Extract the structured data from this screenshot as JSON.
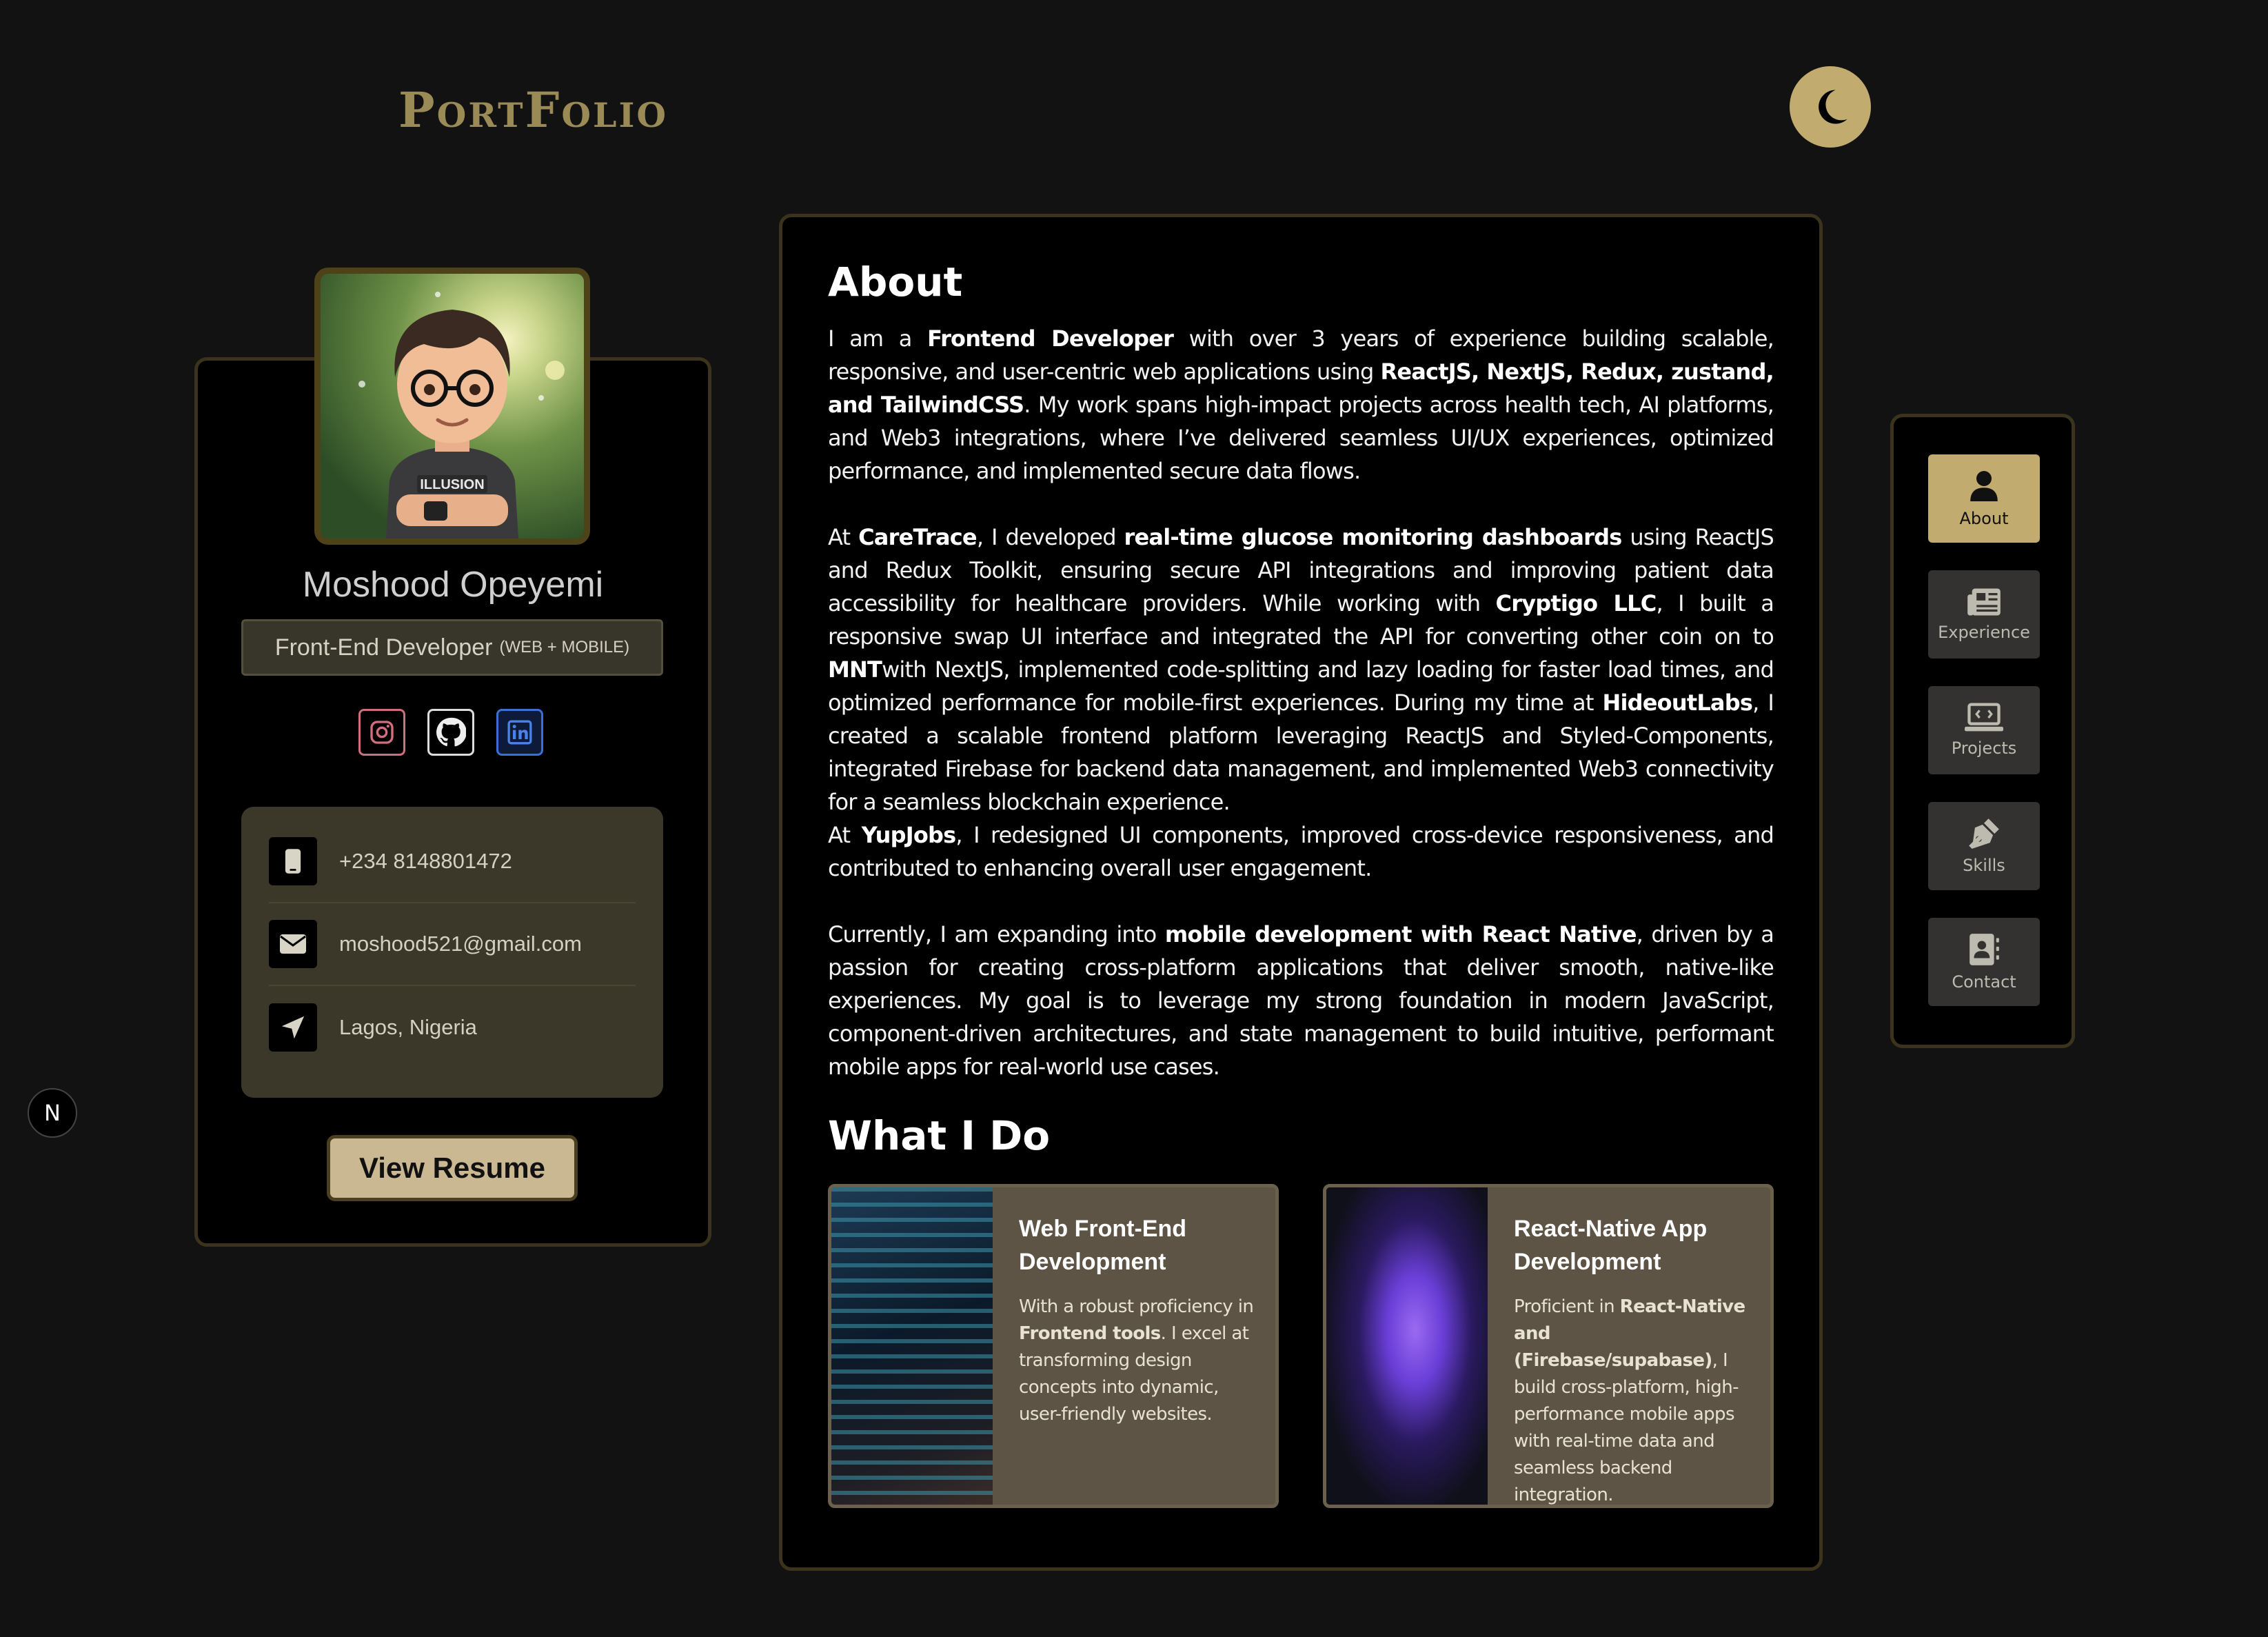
{
  "header": {
    "logo": "PortFolio",
    "theme_toggle_icon": "moon-icon"
  },
  "profile": {
    "name": "Moshood Opeyemi",
    "role": "Front-End Developer",
    "role_sub": "(WEB + MOBILE)",
    "socials": [
      {
        "icon": "instagram-icon"
      },
      {
        "icon": "github-icon"
      },
      {
        "icon": "linkedin-icon"
      }
    ],
    "contacts": {
      "phone": "+234 8148801472",
      "email": "moshood521@gmail.com",
      "location": "Lagos, Nigeria"
    },
    "resume_label": "View Resume"
  },
  "about": {
    "title": "About",
    "p1": {
      "a": "I am a ",
      "b1": "Frontend Developer",
      "c": " with over 3 years of experience building scalable, responsive, and user-centric web applications using ",
      "b2": "ReactJS, NextJS, Redux, zustand, and TailwindCSS",
      "d": ". My work spans high-impact projects across health tech, AI platforms, and Web3 integrations, where I’ve delivered seamless UI/UX experiences, optimized performance, and implemented secure data flows."
    },
    "p2": {
      "a": "At ",
      "b1": "CareTrace",
      "c": ", I developed ",
      "b2": "real-time glucose monitoring dashboards",
      "d": " using ReactJS and Redux Toolkit, ensuring secure API integrations and improving patient data accessibility for healthcare providers. While working with ",
      "b3": "Cryptigo LLC",
      "e": ", I built a responsive swap UI interface and integrated the API for converting other coin on to ",
      "b4": "MNT",
      "f": "with NextJS, implemented code-splitting and lazy loading for faster load times, and optimized performance for mobile-first experiences. During my time at ",
      "b5": "HideoutLabs",
      "g": ", I created a scalable frontend platform leveraging ReactJS and Styled-Components, integrated Firebase for backend data management, and implemented Web3 connectivity for a seamless blockchain experience."
    },
    "p3": {
      "a": "At ",
      "b1": "YupJobs",
      "c": ", I redesigned UI components, improved cross-device responsiveness, and contributed to enhancing overall user engagement."
    },
    "p4": {
      "a": "Currently, I am expanding into ",
      "b1": "mobile development with React Native",
      "c": ", driven by a passion for creating cross-platform applications that deliver smooth, native-like experiences. My goal is to leverage my strong foundation in modern JavaScript, component-driven architectures, and state management to build intuitive, performant mobile apps for real-world use cases."
    }
  },
  "what_i_do": {
    "title": "What I Do",
    "services": [
      {
        "title": "Web Front-End Development",
        "desc_a": "With a robust proficiency in ",
        "desc_b": "Frontend tools",
        "desc_c": ". I excel at transforming design concepts into dynamic, user-friendly websites."
      },
      {
        "title": "React-Native App Development",
        "desc_a": "Proficient in ",
        "desc_b": "React-Native and (Firebase/supabase)",
        "desc_c": ", I build cross-platform, high-performance mobile apps with real-time data and seamless backend integration."
      }
    ]
  },
  "nav": {
    "items": [
      {
        "label": "About",
        "icon": "user-icon",
        "active": true
      },
      {
        "label": "Experience",
        "icon": "newspaper-icon"
      },
      {
        "label": "Projects",
        "icon": "laptop-code-icon"
      },
      {
        "label": "Skills",
        "icon": "pen-nib-icon"
      },
      {
        "label": "Contact",
        "icon": "address-book-icon"
      }
    ]
  },
  "next_badge": "N",
  "colors": {
    "accent": "#c2ab6e",
    "background": "#121212",
    "card": "#000000",
    "border": "#3b331c"
  }
}
